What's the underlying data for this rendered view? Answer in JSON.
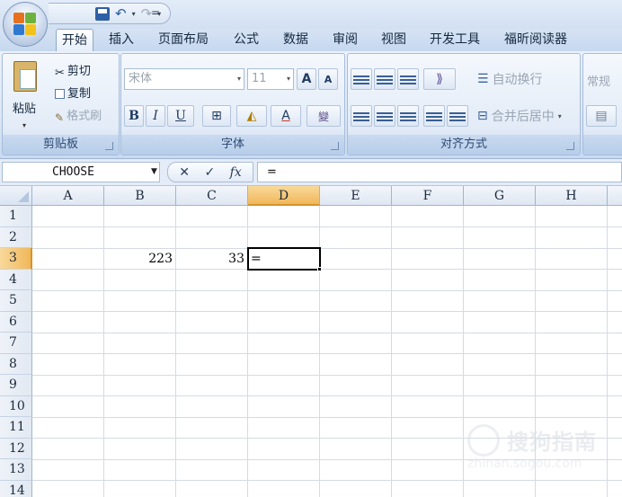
{
  "quick_access": {
    "more": "="
  },
  "tabs": [
    "开始",
    "插入",
    "页面布局",
    "公式",
    "数据",
    "审阅",
    "视图",
    "开发工具",
    "福昕阅读器"
  ],
  "active_tab": "开始",
  "clipboard": {
    "paste": "粘贴",
    "cut": "剪切",
    "copy": "复制",
    "format_painter": "格式刷",
    "label": "剪贴板"
  },
  "font": {
    "name": "宋体",
    "size": "11",
    "label": "字体",
    "bold": "B",
    "italic": "I",
    "underline": "U",
    "grow": "A",
    "shrink": "A",
    "font_color": "A",
    "phonetic": "變"
  },
  "alignment": {
    "wrap_text": "自动换行",
    "merge_center": "合并后居中",
    "label": "对齐方式"
  },
  "number": {
    "format": "常规"
  },
  "formula_bar": {
    "name_box": "CHOOSE",
    "fx": "fx",
    "cancel": "✕",
    "enter": "✓",
    "content": "="
  },
  "sheet": {
    "columns": [
      "A",
      "B",
      "C",
      "D",
      "E",
      "F",
      "G",
      "H"
    ],
    "rows": [
      "1",
      "2",
      "3",
      "4",
      "5",
      "6",
      "7",
      "8",
      "9",
      "10",
      "11",
      "12",
      "13",
      "14"
    ],
    "selected_column": "D",
    "selected_row": "3",
    "cells": {
      "B3": "223",
      "C3": "33",
      "D3": "="
    }
  },
  "watermark": {
    "title": "搜狗指南",
    "url": "zhinan.sogou.com"
  }
}
